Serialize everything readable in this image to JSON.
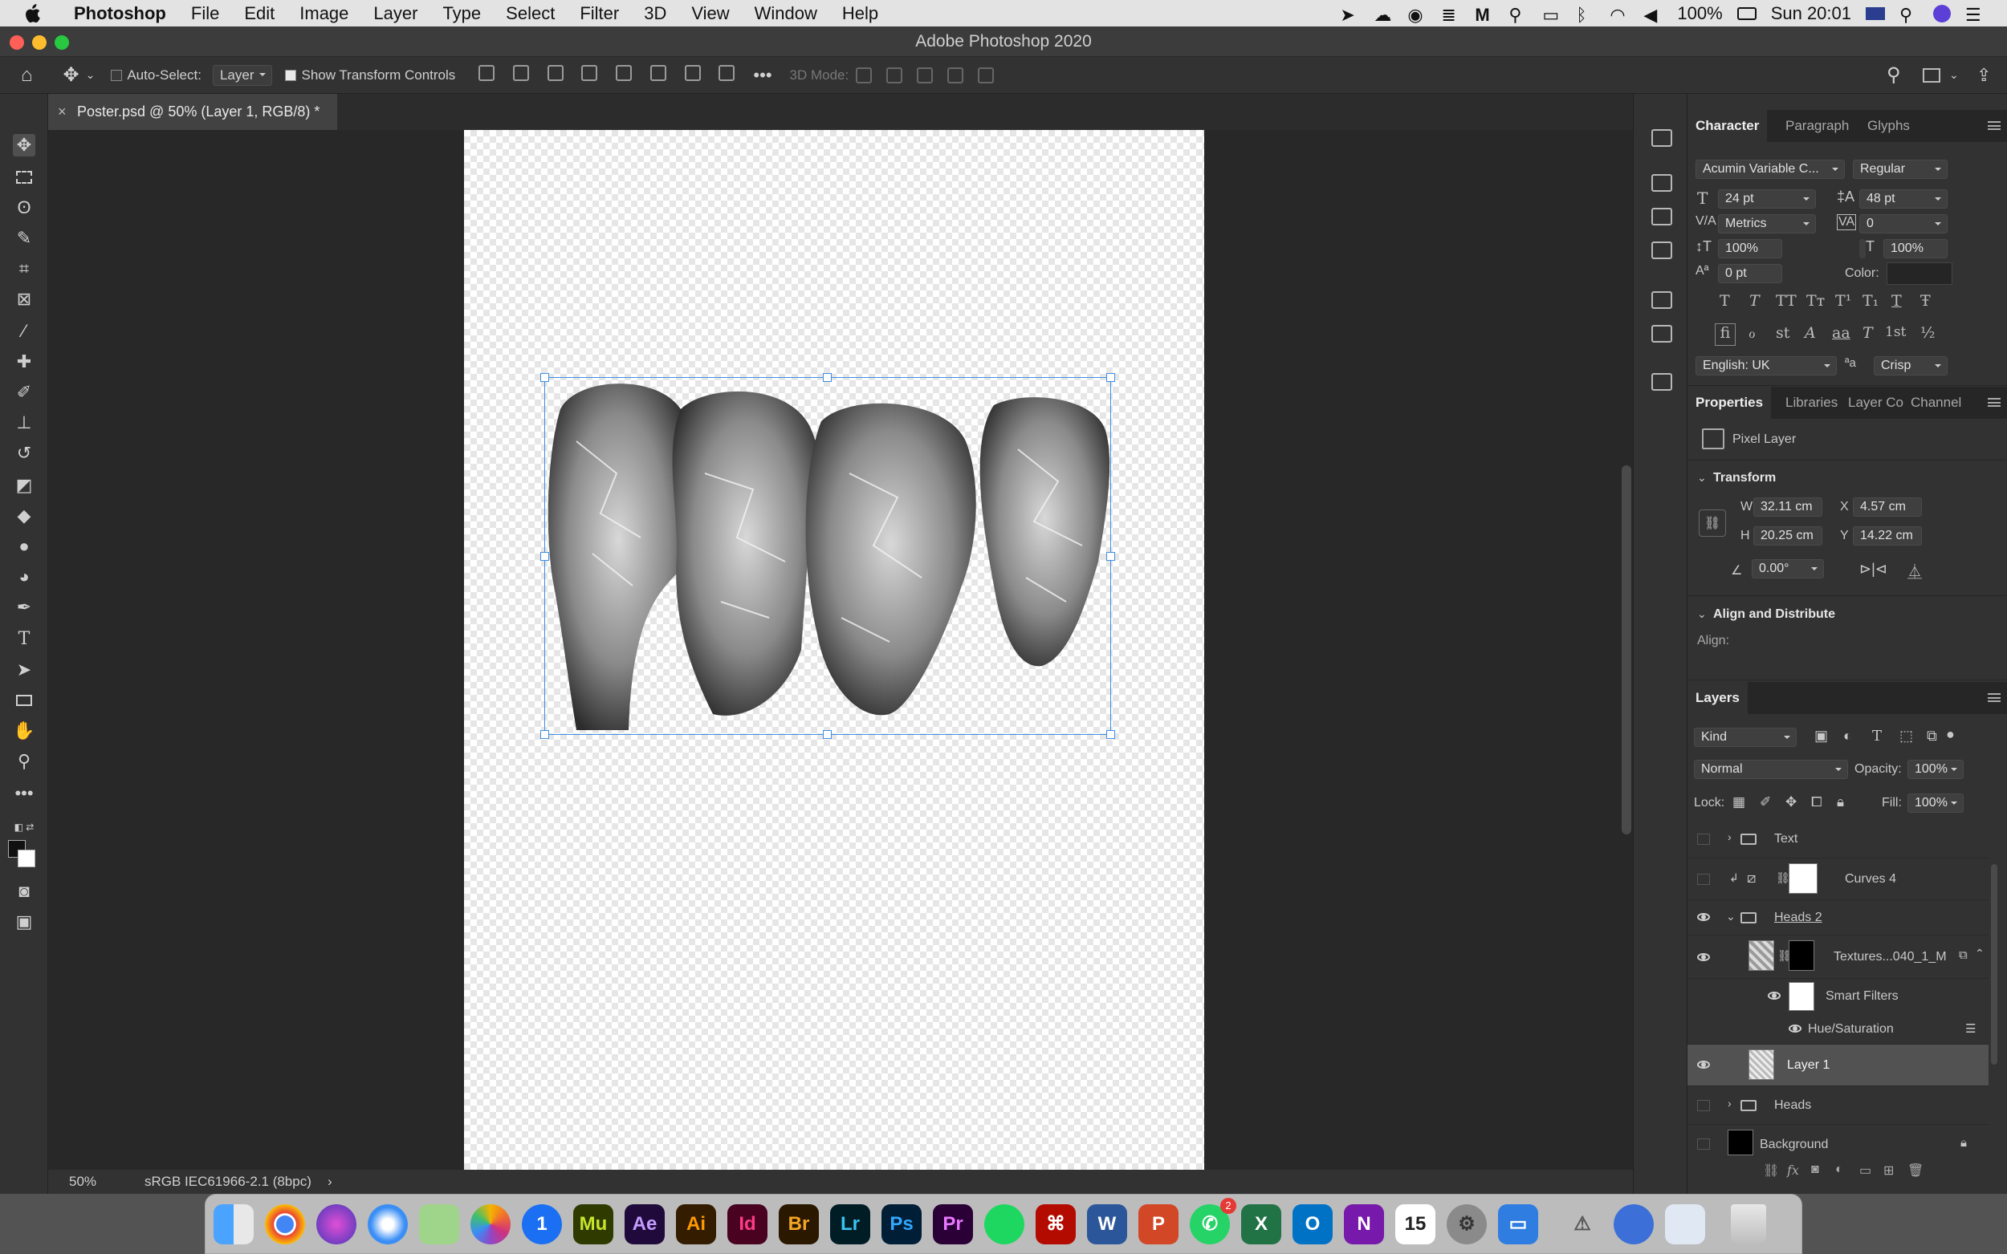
{
  "menubar": {
    "app_name": "Photoshop",
    "items": [
      "File",
      "Edit",
      "Image",
      "Layer",
      "Type",
      "Select",
      "Filter",
      "3D",
      "View",
      "Window",
      "Help"
    ],
    "battery": "100%",
    "clock": "Sun 20:01"
  },
  "window": {
    "title": "Adobe Photoshop 2020"
  },
  "options": {
    "auto_select_label": "Auto-Select:",
    "auto_select_target": "Layer",
    "show_transform_label": "Show Transform Controls",
    "mode_3d_label": "3D Mode:"
  },
  "document": {
    "tab_title": "Poster.psd @ 50% (Layer 1, RGB/8) *",
    "close_symbol": "×"
  },
  "status": {
    "zoom": "50%",
    "profile": "sRGB IEC61966-2.1 (8bpc)",
    "arrow": "›"
  },
  "character": {
    "tabs": [
      "Character",
      "Paragraph",
      "Glyphs"
    ],
    "font_family": "Acumin Variable C...",
    "font_style": "Regular",
    "size": "24 pt",
    "leading": "48 pt",
    "kerning": "Metrics",
    "tracking": "0",
    "vscale": "100%",
    "hscale": "100%",
    "baseline": "0 pt",
    "color_label": "Color:",
    "language": "English: UK",
    "antialias": "Crisp",
    "aa_symbol": "ªa",
    "style_glyphs_row1": [
      "T",
      "T",
      "TT",
      "Tт",
      "T¹",
      "T₁",
      "T",
      "Ŧ"
    ],
    "style_glyphs_row2": [
      "ﬁ",
      "ℴ",
      "st",
      "A",
      "aa",
      "T",
      "1st",
      "½"
    ]
  },
  "properties": {
    "tabs": [
      "Properties",
      "Libraries",
      "Layer Co",
      "Channel"
    ],
    "layer_type": "Pixel Layer",
    "transform_heading": "Transform",
    "w_label": "W",
    "w_value": "32.11 cm",
    "x_label": "X",
    "x_value": "4.57 cm",
    "h_label": "H",
    "h_value": "20.25 cm",
    "y_label": "Y",
    "y_value": "14.22 cm",
    "angle_value": "0.00°",
    "align_heading": "Align and Distribute",
    "align_label": "Align:"
  },
  "layers": {
    "title": "Layers",
    "filter_kind": "Kind",
    "blend_mode": "Normal",
    "opacity_label": "Opacity:",
    "opacity_value": "100%",
    "lock_label": "Lock:",
    "fill_label": "Fill:",
    "fill_value": "100%",
    "rows": [
      {
        "name": "Text"
      },
      {
        "name": "Curves 4"
      },
      {
        "name": "Heads 2"
      },
      {
        "name": "Textures...040_1_M"
      },
      {
        "name": "Smart Filters"
      },
      {
        "name": "Hue/Saturation"
      },
      {
        "name": "Layer 1"
      },
      {
        "name": "Heads"
      },
      {
        "name": "Background"
      }
    ]
  },
  "dock": {
    "apps": [
      "Finder",
      "Chrome",
      "Siri",
      "Safari",
      "Maps",
      "Photos",
      "1Password",
      "Mu",
      "Ae",
      "Ai",
      "Id",
      "Br",
      "Lr",
      "Ps",
      "Pr",
      "Spotify",
      "Acrobat",
      "W",
      "P",
      "WhatsApp",
      "X",
      "O",
      "N",
      "15",
      "System Preferences",
      "Keynote",
      "Xcode",
      "Instruments",
      "Preview",
      "Trash"
    ],
    "whatsapp_badge": "2"
  }
}
